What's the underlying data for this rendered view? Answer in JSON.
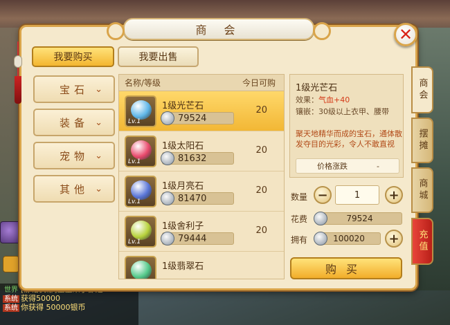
{
  "window": {
    "title": "商 会",
    "close_icon": "close-icon"
  },
  "top_tabs": {
    "buy": "我要购买",
    "sell": "我要出售"
  },
  "categories": [
    {
      "label": "宝石"
    },
    {
      "label": "装备"
    },
    {
      "label": "宠物"
    },
    {
      "label": "其他"
    }
  ],
  "list": {
    "header_name": "名称/等级",
    "header_qty": "今日可购",
    "items": [
      {
        "name": "1级光芒石",
        "level": "Lv.1",
        "price": "79524",
        "qty": "20",
        "color": "#5fb6e8"
      },
      {
        "name": "1级太阳石",
        "level": "Lv.1",
        "price": "81632",
        "qty": "20",
        "color": "#e84a6c"
      },
      {
        "name": "1级月亮石",
        "level": "Lv.1",
        "price": "81470",
        "qty": "20",
        "color": "#5a76d8"
      },
      {
        "name": "1级舍利子",
        "level": "Lv.1",
        "price": "79444",
        "qty": "20",
        "color": "#b7d23c"
      },
      {
        "name": "1级翡翠石",
        "level": "Lv.1",
        "price": "",
        "qty": "",
        "color": "#54c98a"
      }
    ]
  },
  "detail": {
    "title": "1级光芒石",
    "effect_label": "效果：",
    "effect_value": "气血+40",
    "inlay": "镶嵌：30级以上衣甲、腰带",
    "description": "聚天地精华而成的宝石，通体散发夺目的光彩，令人不敢直视",
    "trend_label": "价格涨跌",
    "trend_value": "-"
  },
  "purchase": {
    "qty_label": "数量",
    "qty_value": "1",
    "cost_label": "花费",
    "cost_value": "79524",
    "own_label": "拥有",
    "own_value": "100020",
    "buy_label": "购买"
  },
  "side_tabs": [
    {
      "label": "商会"
    },
    {
      "label": "摆摊"
    },
    {
      "label": "商城"
    },
    {
      "label": "充值"
    }
  ],
  "chat": [
    {
      "tag": "世界",
      "text": "[静怡安娜]宝宝来了都是"
    },
    {
      "tag": "系统",
      "text": "获得50000"
    },
    {
      "tag": "系统",
      "text": "你获得 50000银币"
    }
  ],
  "colors": {
    "accent": "#f2b735",
    "frame": "#d9a44a",
    "recharge": "#c52a20"
  }
}
